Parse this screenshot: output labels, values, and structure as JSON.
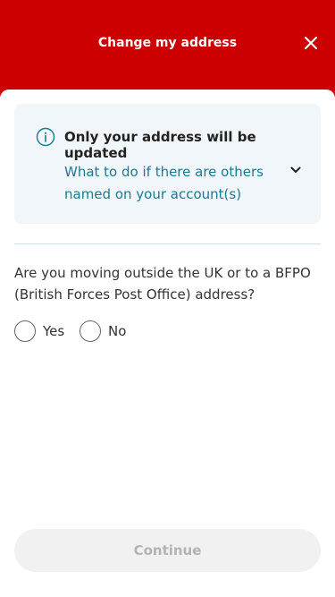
{
  "header": {
    "title": "Change my address",
    "close_icon": "close-icon"
  },
  "info": {
    "icon": "info-icon",
    "title": "Only your address will be updated",
    "link_text": "What to do if there are others named on your account(s)",
    "chevron_icon": "chevron-down-icon"
  },
  "form": {
    "question": "Are you moving outside the UK or to a BFPO (British Forces Post Office) address?",
    "options": [
      {
        "label": "Yes",
        "selected": false
      },
      {
        "label": "No",
        "selected": false
      }
    ]
  },
  "footer": {
    "continue_label": "Continue",
    "continue_enabled": false
  },
  "colors": {
    "brand": "#cc0000",
    "link": "#1a7a94",
    "info_bg": "#f1f6fa"
  }
}
